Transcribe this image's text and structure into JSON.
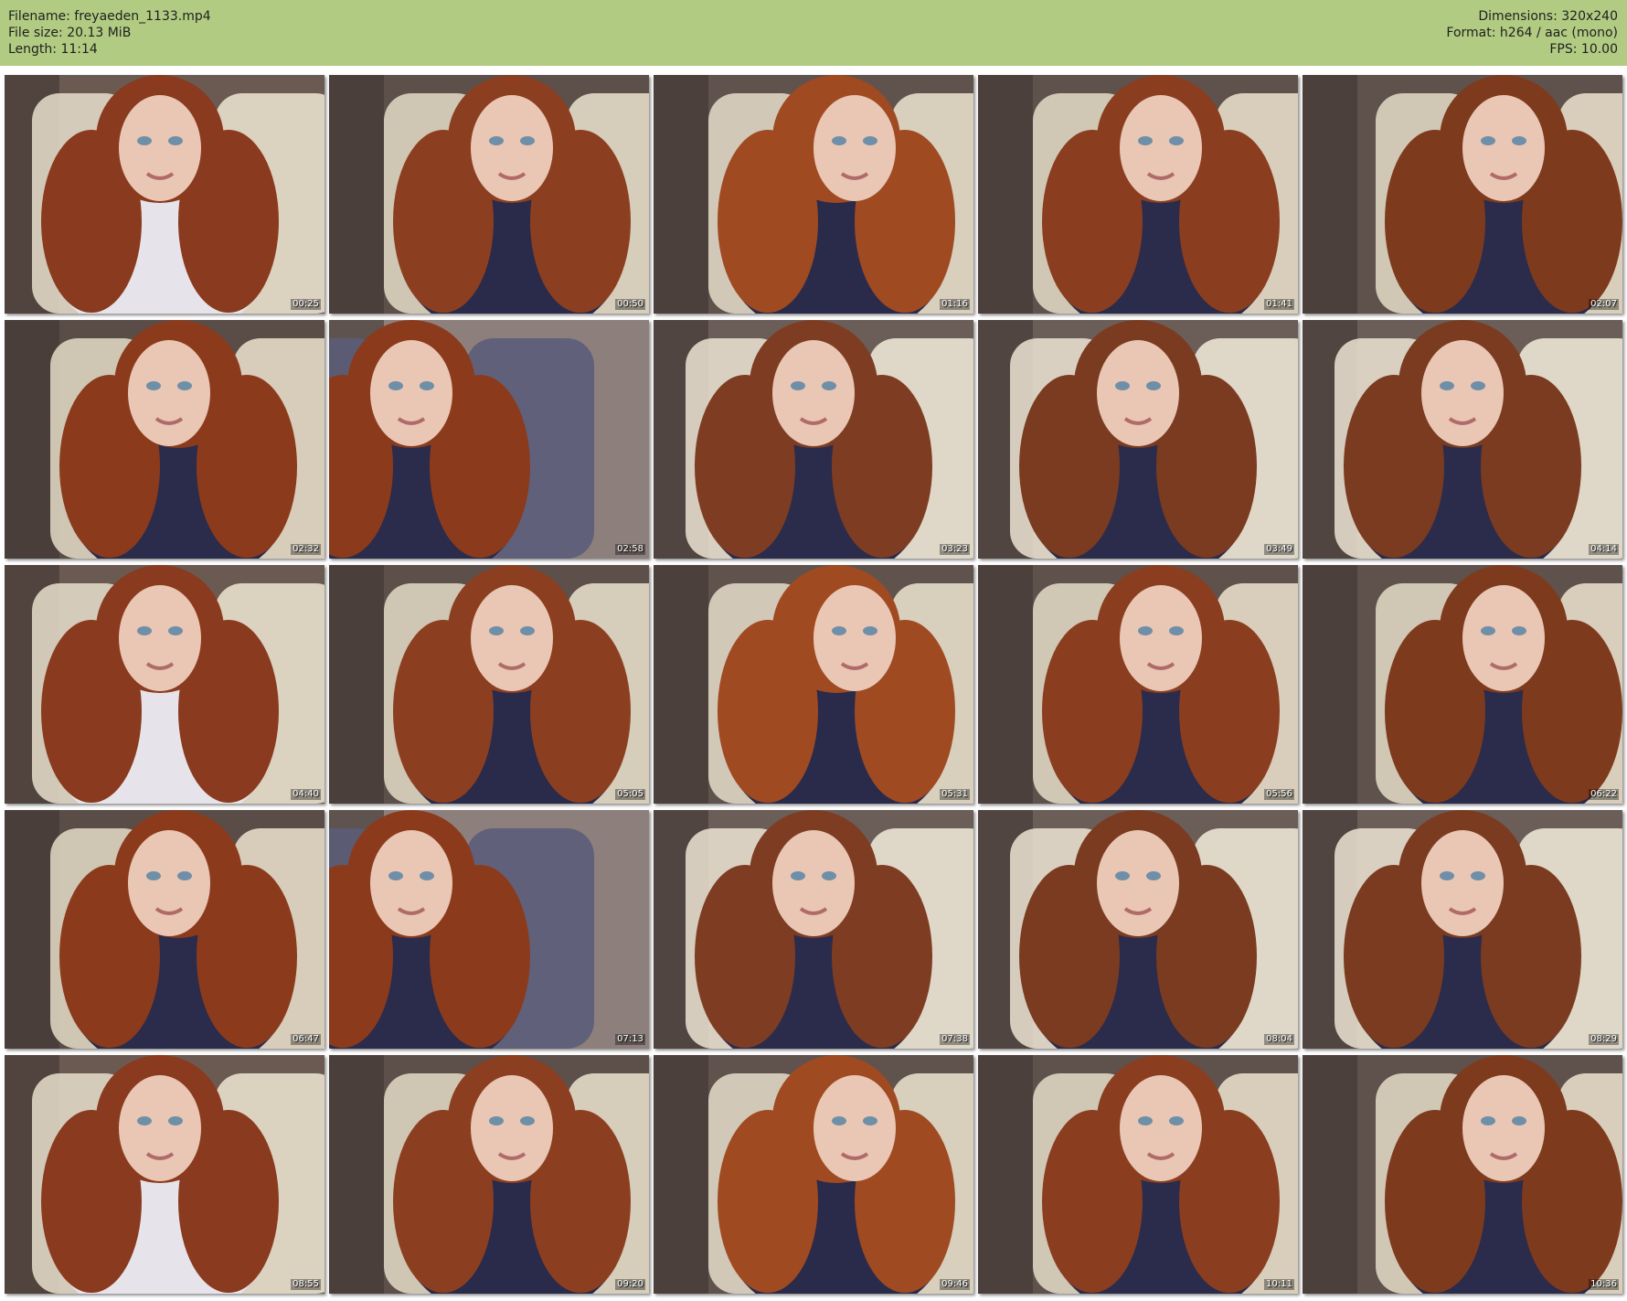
{
  "header": {
    "filename": "Filename: freyaeden_1133.mp4",
    "filesize": "File size: 20.13 MiB",
    "length": "Length: 11:14",
    "dimensions": "Dimensions: 320x240",
    "format": "Format: h264 / aac (mono)",
    "fps": "FPS: 10.00"
  },
  "thumbnails": [
    {
      "time": "00:25"
    },
    {
      "time": "00:50"
    },
    {
      "time": "01:16"
    },
    {
      "time": "01:41"
    },
    {
      "time": "02:07"
    },
    {
      "time": "02:32"
    },
    {
      "time": "02:58"
    },
    {
      "time": "03:23"
    },
    {
      "time": "03:49"
    },
    {
      "time": "04:14"
    },
    {
      "time": "04:40"
    },
    {
      "time": "05:05"
    },
    {
      "time": "05:31"
    },
    {
      "time": "05:56"
    },
    {
      "time": "06:22"
    },
    {
      "time": "06:47"
    },
    {
      "time": "07:13"
    },
    {
      "time": "07:38"
    },
    {
      "time": "08:04"
    },
    {
      "time": "08:29"
    },
    {
      "time": "08:55"
    },
    {
      "time": "09:20"
    },
    {
      "time": "09:46"
    },
    {
      "time": "10:11"
    },
    {
      "time": "10:36"
    }
  ]
}
